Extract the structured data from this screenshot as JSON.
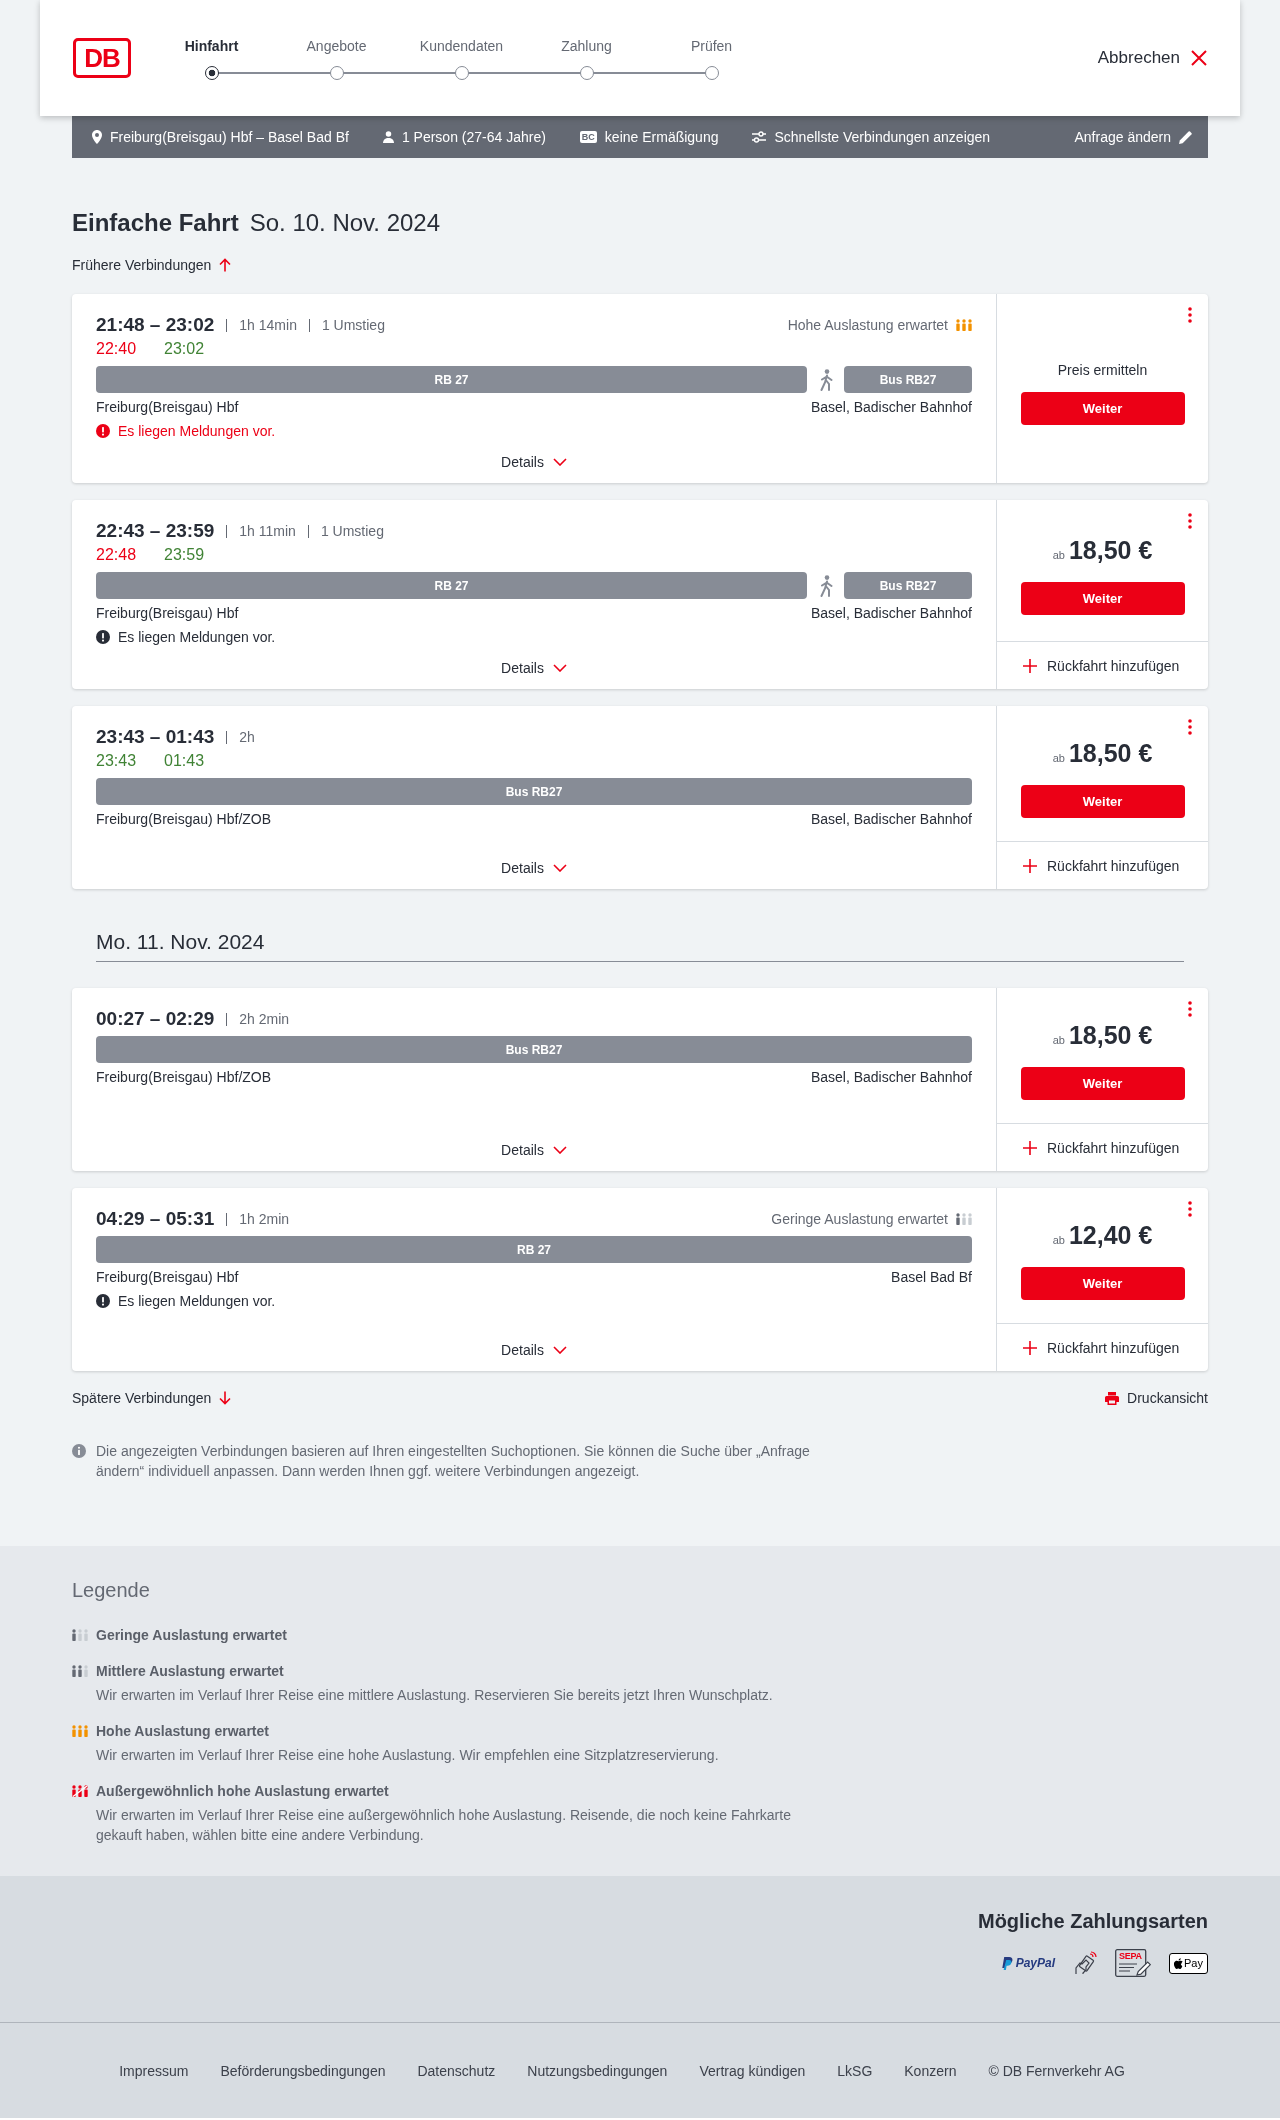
{
  "header": {
    "logo": "DB",
    "steps": [
      {
        "label": "Hinfahrt",
        "selected": true
      },
      {
        "label": "Angebote",
        "selected": false
      },
      {
        "label": "Kundendaten",
        "selected": false
      },
      {
        "label": "Zahlung",
        "selected": false
      },
      {
        "label": "Prüfen",
        "selected": false
      }
    ],
    "cancel": "Abbrechen"
  },
  "search_summary": {
    "route": "Freiburg(Breisgau) Hbf – Basel Bad Bf",
    "travellers": "1 Person (27-64 Jahre)",
    "card_badge": "BC",
    "discount": "keine Ermäßigung",
    "sort": "Schnellste Verbindungen anzeigen",
    "edit": "Anfrage ändern"
  },
  "trip": {
    "type": "Einfache Fahrt",
    "date": "So. 10. Nov. 2024"
  },
  "earlier_link": "Frühere Verbindungen",
  "days": [
    {
      "connections": [
        {
          "times": "21:48 – 23:02",
          "duration": "1h 14min",
          "transfers": "1 Umstieg",
          "occupancy": {
            "kind": "high",
            "text": "Hohe Auslastung erwartet"
          },
          "realtime": [
            {
              "time": "22:40",
              "delayed": true
            },
            {
              "time": "23:02",
              "delayed": false
            }
          ],
          "segments": [
            {
              "kind": "train",
              "label": "RB 27"
            },
            {
              "kind": "walk"
            },
            {
              "kind": "bus",
              "label": "Bus RB27"
            }
          ],
          "from": "Freiburg(Breisgau) Hbf",
          "to": "Basel, Badischer Bahnhof",
          "message": {
            "text": "Es liegen Meldungen vor.",
            "urgent": true
          },
          "details": "Details",
          "offer": {
            "kind": "on_request",
            "text": "Preis ermitteln"
          },
          "button": "Weiter"
        },
        {
          "times": "22:43 – 23:59",
          "duration": "1h 11min",
          "transfers": "1 Umstieg",
          "realtime": [
            {
              "time": "22:48",
              "delayed": true
            },
            {
              "time": "23:59",
              "delayed": false
            }
          ],
          "segments": [
            {
              "kind": "train",
              "label": "RB 27"
            },
            {
              "kind": "walk"
            },
            {
              "kind": "bus",
              "label": "Bus RB27"
            }
          ],
          "from": "Freiburg(Breisgau) Hbf",
          "to": "Basel, Badischer Bahnhof",
          "message": {
            "text": "Es liegen Meldungen vor.",
            "urgent": false
          },
          "details": "Details",
          "offer": {
            "kind": "price",
            "prefix": "ab",
            "amount": "18,50 €"
          },
          "button": "Weiter",
          "return_link": "Rückfahrt hinzufügen"
        },
        {
          "times": "23:43 – 01:43",
          "duration": "2h",
          "realtime": [
            {
              "time": "23:43",
              "delayed": false
            },
            {
              "time": "01:43",
              "delayed": false
            }
          ],
          "segments": [
            {
              "kind": "bus",
              "label": "Bus RB27"
            }
          ],
          "from": "Freiburg(Breisgau) Hbf/ZOB",
          "to": "Basel, Badischer Bahnhof",
          "details": "Details",
          "offer": {
            "kind": "price",
            "prefix": "ab",
            "amount": "18,50 €"
          },
          "button": "Weiter",
          "return_link": "Rückfahrt hinzufügen"
        }
      ]
    },
    {
      "date": "Mo. 11. Nov. 2024",
      "connections": [
        {
          "times": "00:27 – 02:29",
          "duration": "2h 2min",
          "segments": [
            {
              "kind": "bus",
              "label": "Bus RB27"
            }
          ],
          "from": "Freiburg(Breisgau) Hbf/ZOB",
          "to": "Basel, Badischer Bahnhof",
          "details": "Details",
          "offer": {
            "kind": "price",
            "prefix": "ab",
            "amount": "18,50 €"
          },
          "button": "Weiter",
          "return_link": "Rückfahrt hinzufügen"
        },
        {
          "times": "04:29 – 05:31",
          "duration": "1h 2min",
          "occupancy": {
            "kind": "low",
            "text": "Geringe Auslastung erwartet"
          },
          "segments": [
            {
              "kind": "train",
              "label": "RB 27"
            }
          ],
          "from": "Freiburg(Breisgau) Hbf",
          "to": "Basel Bad Bf",
          "message": {
            "text": "Es liegen Meldungen vor.",
            "urgent": false
          },
          "details": "Details",
          "offer": {
            "kind": "price",
            "prefix": "ab",
            "amount": "12,40 €"
          },
          "button": "Weiter",
          "return_link": "Rückfahrt hinzufügen"
        }
      ]
    }
  ],
  "later_link": "Spätere Verbindungen",
  "print_link": "Druckansicht",
  "notice": "Die angezeigten Verbindungen basieren auf Ihren eingestellten Suchoptionen. Sie können die Suche über „Anfrage ändern“ individuell anpassen. Dann werden Ihnen ggf. weitere Verbindungen angezeigt.",
  "legend": {
    "title": "Legende",
    "items": [
      {
        "kind": "low",
        "title": "Geringe Auslastung erwartet"
      },
      {
        "kind": "medium",
        "title": "Mittlere Auslastung erwartet",
        "text": "Wir erwarten im Verlauf Ihrer Reise eine mittlere Auslastung. Reservieren Sie bereits jetzt Ihren Wunschplatz."
      },
      {
        "kind": "high",
        "title": "Hohe Auslastung erwartet",
        "text": "Wir erwarten im Verlauf Ihrer Reise eine hohe Auslastung. Wir empfehlen eine Sitzplatzreservierung."
      },
      {
        "kind": "very_high",
        "title": "Außergewöhnlich hohe Auslastung erwartet",
        "text": "Wir erwarten im Verlauf Ihrer Reise eine außergewöhnlich hohe Auslastung. Reisende, die noch keine Fahrkarte gekauft haben, wählen bitte eine andere Verbindung."
      }
    ]
  },
  "payment": {
    "title": "Mögliche Zahlungsarten",
    "methods": [
      {
        "kind": "paypal",
        "label": "PayPal"
      },
      {
        "kind": "contactless"
      },
      {
        "kind": "sepa",
        "label": "SEPA"
      },
      {
        "kind": "applepay",
        "label": "Pay"
      }
    ]
  },
  "footer_links": [
    "Impressum",
    "Beförderungsbedingungen",
    "Datenschutz",
    "Nutzungsbedingungen",
    "Vertrag kündigen",
    "LkSG",
    "Konzern",
    "© DB Fernverkehr AG"
  ]
}
